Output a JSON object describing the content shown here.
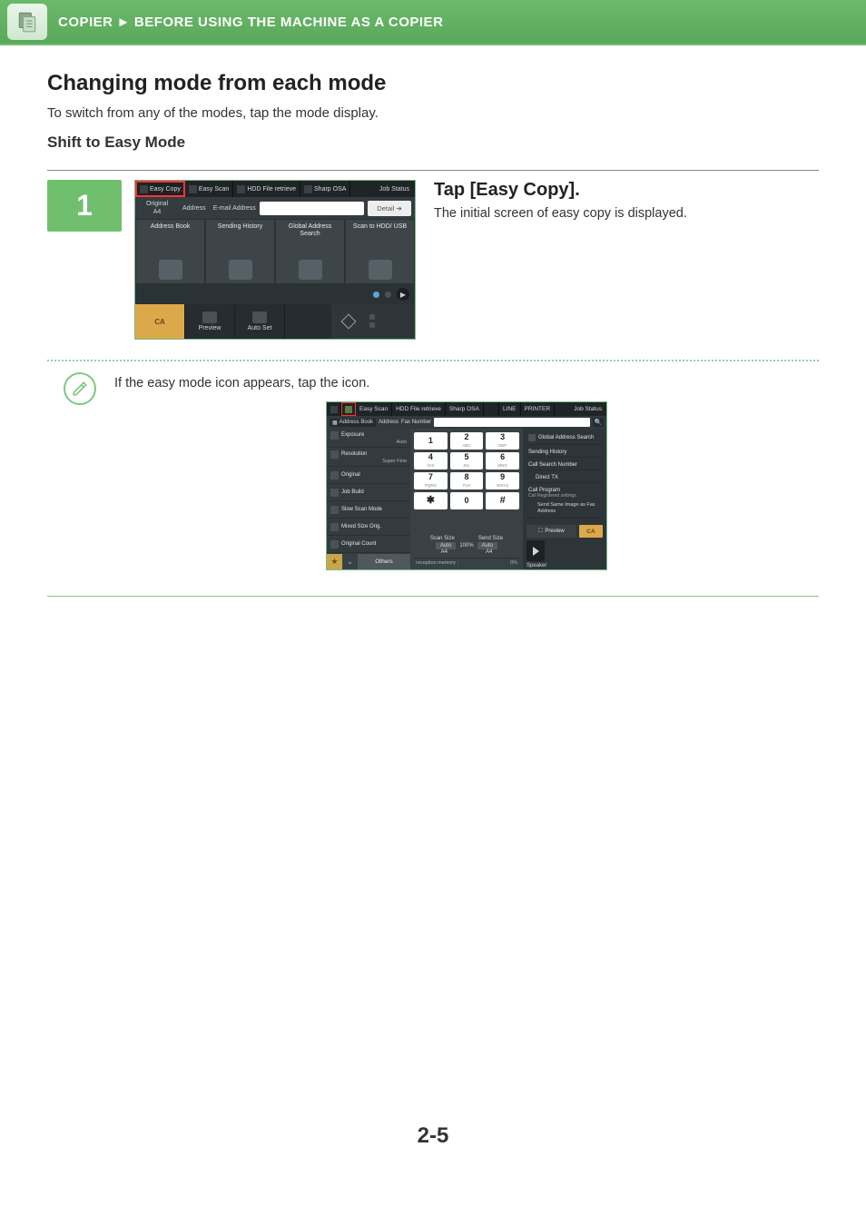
{
  "breadcrumb": {
    "section": "COPIER",
    "arrow": "►",
    "page": "BEFORE USING THE MACHINE AS A COPIER"
  },
  "heading": "Changing mode from each mode",
  "intro": "To switch from any of the modes, tap the mode display.",
  "subheading": "Shift to Easy Mode",
  "step1": {
    "number": "1",
    "title": "Tap [Easy Copy].",
    "desc": "The initial screen of easy copy is displayed."
  },
  "note_text": "If the easy mode icon appears, tap the icon.",
  "page_number": "2-5",
  "ssA": {
    "tabs": {
      "easy_copy": "Easy Copy",
      "easy_scan": "Easy Scan",
      "hdd": "HDD File retrieve",
      "sharp_osa": "Sharp OSA",
      "job_status": "Job Status"
    },
    "original_label": "Original",
    "original_value": "A4",
    "address_label": "Address",
    "address_field_label": "E-mail Address",
    "detail": "Detail",
    "cells": {
      "address_book": "Address Book",
      "sending_history": "Sending History",
      "global_search": "Global Address Search",
      "scan_hdd_usb": "Scan to HDD/ USB"
    },
    "bottom": {
      "ca": "CA",
      "preview": "Preview",
      "auto_set": "Auto Set"
    }
  },
  "ssB": {
    "tabs": {
      "easy_scan": "Easy Scan",
      "hdd": "HDD File retrieve",
      "sharp_osa": "Sharp OSA",
      "line": "LINE",
      "printer": "PRINTER",
      "job_status": "Job Status"
    },
    "row2": {
      "address_book": "Address Book",
      "address_lbl": "Address",
      "fax_number": "Fax Number"
    },
    "left": {
      "exposure": "Exposure",
      "exposure_val": "Auto",
      "resolution": "Resolution",
      "resolution_val": "Super Fine",
      "original": "Original",
      "job_build": "Job Build",
      "slow_scan": "Slow Scan Mode",
      "mixed": "Mixed Size Orig.",
      "orig_count": "Original Count",
      "others": "Others"
    },
    "keypad": {
      "k1": "1",
      "k2": "2",
      "k2s": "ABC",
      "k3": "3",
      "k3s": "DEF",
      "k4": "4",
      "k4s": "GHI",
      "k5": "5",
      "k5s": "JKL",
      "k6": "6",
      "k6s": "MNO",
      "k7": "7",
      "k7s": "PQRS",
      "k8": "8",
      "k8s": "TUV",
      "k9": "9",
      "k9s": "WXYZ",
      "kstar": "✱",
      "k0": "0",
      "khash": "#"
    },
    "sizes": {
      "scan_lbl": "Scan Size",
      "send_lbl": "Send Size",
      "auto": "Auto",
      "ratio": "100%",
      "a4": "A4"
    },
    "mem": {
      "label": "reception memory :",
      "value": "0%"
    },
    "right": {
      "global_search": "Global Address Search",
      "sending_history": "Sending History",
      "call_search": "Call Search Number",
      "direct_tx": "Direct TX",
      "call_program": "Call Program",
      "call_program_sub": "Call Registered settings",
      "send_same": "Send Same Image as Fax Address",
      "preview": "Preview",
      "ca": "CA",
      "speaker": "Speaker"
    }
  }
}
